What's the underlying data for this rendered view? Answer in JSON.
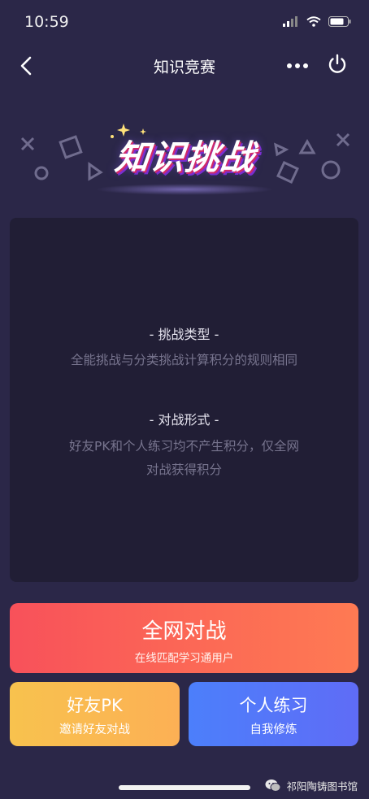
{
  "status_bar": {
    "time": "10:59"
  },
  "nav": {
    "title": "知识竞赛"
  },
  "banner": {
    "title": "知识挑战"
  },
  "rules": {
    "type_heading": "- 挑战类型 -",
    "type_text": "全能挑战与分类挑战计算积分的规则相同",
    "form_heading": "- 对战形式 -",
    "form_text_line1": "好友PK和个人练习均不产生积分，仅全网",
    "form_text_line2": "对战获得积分"
  },
  "buttons": {
    "main": {
      "label": "全网对战",
      "sub": "在线匹配学习通用户"
    },
    "friend": {
      "label": "好友PK",
      "sub": "邀请好友对战"
    },
    "practice": {
      "label": "个人练习",
      "sub": "自我修炼"
    }
  },
  "watermark": {
    "text": "祁阳陶铸图书馆"
  },
  "colors": {
    "background": "#2b2748",
    "card": "#211e35",
    "main_button": "#fa5f57",
    "friend_button": "#fab951",
    "practice_button": "#5176f9"
  }
}
